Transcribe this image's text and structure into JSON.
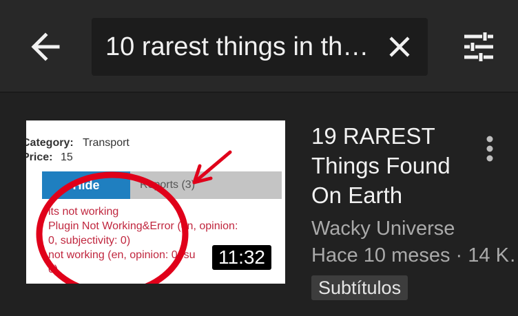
{
  "header": {
    "search_query": "10 rarest things in th…",
    "back_icon": "arrow-left-icon",
    "clear_icon": "close-icon",
    "filter_icon": "sliders-icon"
  },
  "video": {
    "title": "19 RAREST Things Found On Earth",
    "channel": "Wacky Universe",
    "meta": "Hace 10 meses · 14 K…",
    "badge": "Subtítulos",
    "duration": "11:32",
    "menu_icon": "more-vert-icon",
    "thumbnail": {
      "category_label": "Category:",
      "category_value": "Transport",
      "price_label": "Price:",
      "price_value": "15",
      "tab_active": "Hide",
      "tab_reports": "Reports (3)",
      "line1": "its not working",
      "line2": "Plugin Not Working&Error (en, opinion:",
      "line3": "0, subjectivity: 0)",
      "line4": "not working (en, opinion: 0, su",
      "line5": "0)",
      "annotation_color": "#e0001a"
    }
  }
}
